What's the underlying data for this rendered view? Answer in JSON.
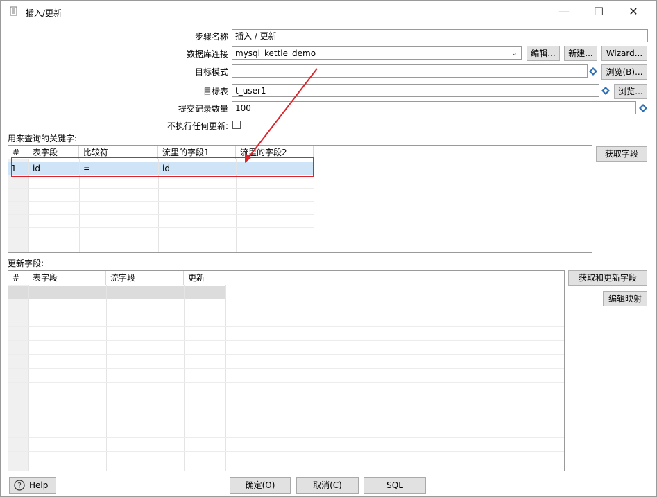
{
  "window": {
    "title": "插入/更新",
    "minimize": "—",
    "maximize": "☐",
    "close": "✕"
  },
  "form": {
    "step_name_label": "步骤名称",
    "step_name_value": "插入 / 更新",
    "db_conn_label": "数据库连接",
    "db_conn_value": "mysql_kettle_demo",
    "edit_btn": "编辑...",
    "new_btn": "新建...",
    "wizard_btn": "Wizard...",
    "target_schema_label": "目标模式",
    "target_schema_value": "",
    "browse_b_btn": "浏览(B)...",
    "target_table_label": "目标表",
    "target_table_value": "t_user1",
    "browse_btn": "浏览...",
    "commit_size_label": "提交记录数量",
    "commit_size_value": "100",
    "no_update_label": "不执行任何更新:"
  },
  "keys_section": {
    "label": "用来查询的关键字:",
    "get_fields_btn": "获取字段",
    "columns": [
      "#",
      "表字段",
      "比较符",
      "流里的字段1",
      "流里的字段2"
    ],
    "rows": [
      {
        "num": "1",
        "table_field": "id",
        "comparator": "=",
        "stream_field1": "id",
        "stream_field2": ""
      }
    ]
  },
  "update_section": {
    "label": "更新字段:",
    "get_update_btn": "获取和更新字段",
    "edit_mapping_btn": "编辑映射",
    "columns": [
      "#",
      "表字段",
      "流字段",
      "更新"
    ]
  },
  "footer": {
    "help": "Help",
    "ok": "确定(O)",
    "cancel": "取消(C)",
    "sql": "SQL"
  },
  "colors": {
    "annotation_red": "#e0222a",
    "row_highlight": "#cfe4f7"
  }
}
